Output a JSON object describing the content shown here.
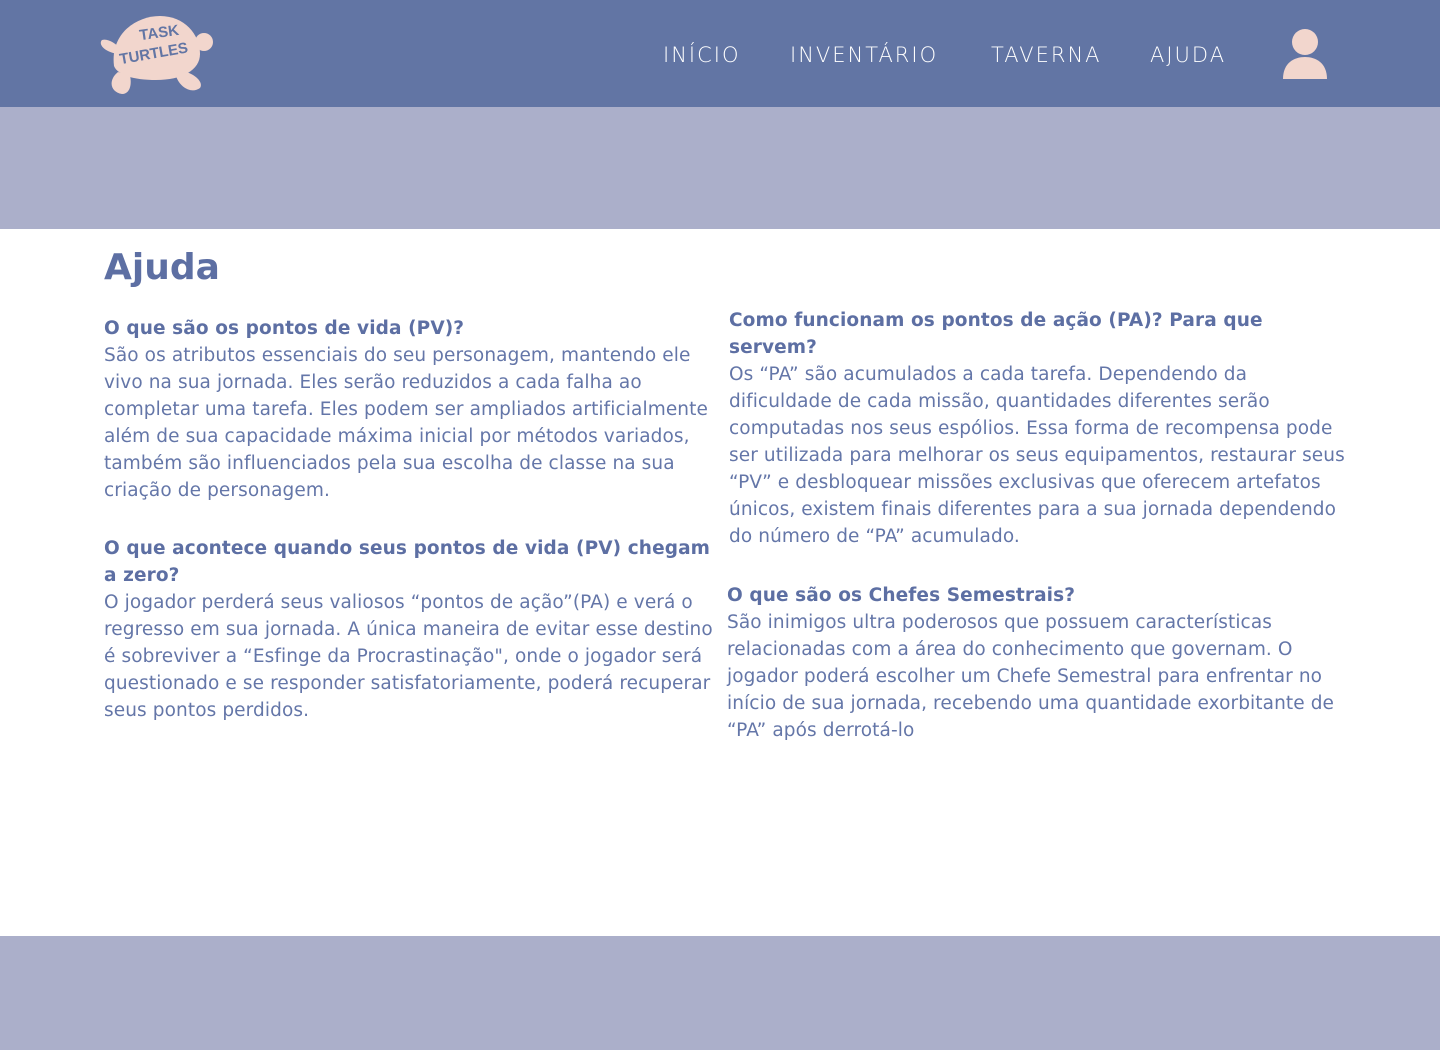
{
  "header": {
    "logo_text": "TASK TURTLES",
    "nav": {
      "inicio": "INÍCIO",
      "inventario": "INVENTÁRIO",
      "taverna": "TAVERNA",
      "ajuda": "AJUDA"
    },
    "avatar_icon": "user-icon"
  },
  "colors": {
    "header_bg": "#6275a4",
    "banner_bg": "#abafca",
    "logo": "#f2d6cd",
    "text": "#6476a8"
  },
  "main": {
    "title": "Ajuda",
    "faq": [
      {
        "question": "O que são os pontos de vida (PV)?",
        "answer": "São os atributos essenciais do seu personagem, mantendo ele vivo na sua jornada. Eles serão reduzidos a cada falha ao completar uma tarefa. Eles podem ser ampliados artificialmente além de sua capacidade máxima inicial por métodos variados, também são influenciados pela sua escolha de classe na sua criação de personagem."
      },
      {
        "question": "O que acontece quando seus pontos de vida (PV) chegam a zero?",
        "answer": "O jogador perderá seus valiosos “pontos de ação”(PA) e verá o regresso em sua jornada. A única maneira de evitar esse destino é sobreviver a “Esfinge da Procrastinação\", onde o jogador será questionado e se responder satisfatoriamente, poderá recuperar seus pontos perdidos."
      },
      {
        "question": "Como funcionam os pontos de ação (PA)? Para que servem?",
        "answer": "Os “PA” são acumulados a cada tarefa. Dependendo da dificuldade de cada missão, quantidades diferentes serão computadas nos seus espólios. Essa forma de recompensa pode ser utilizada para melhorar os seus equipamentos, restaurar seus “PV” e desbloquear missões exclusivas que oferecem artefatos únicos, existem finais diferentes para a sua jornada dependendo do número de “PA” acumulado."
      },
      {
        "question": "O que são os Chefes Semestrais?",
        "answer": "São inimigos ultra poderosos que possuem características relacionadas com a área do conhecimento que governam. O jogador poderá escolher um Chefe Semestral para enfrentar no início de sua jornada, recebendo uma quantidade exorbitante de “PA” após derrotá-lo"
      }
    ]
  }
}
